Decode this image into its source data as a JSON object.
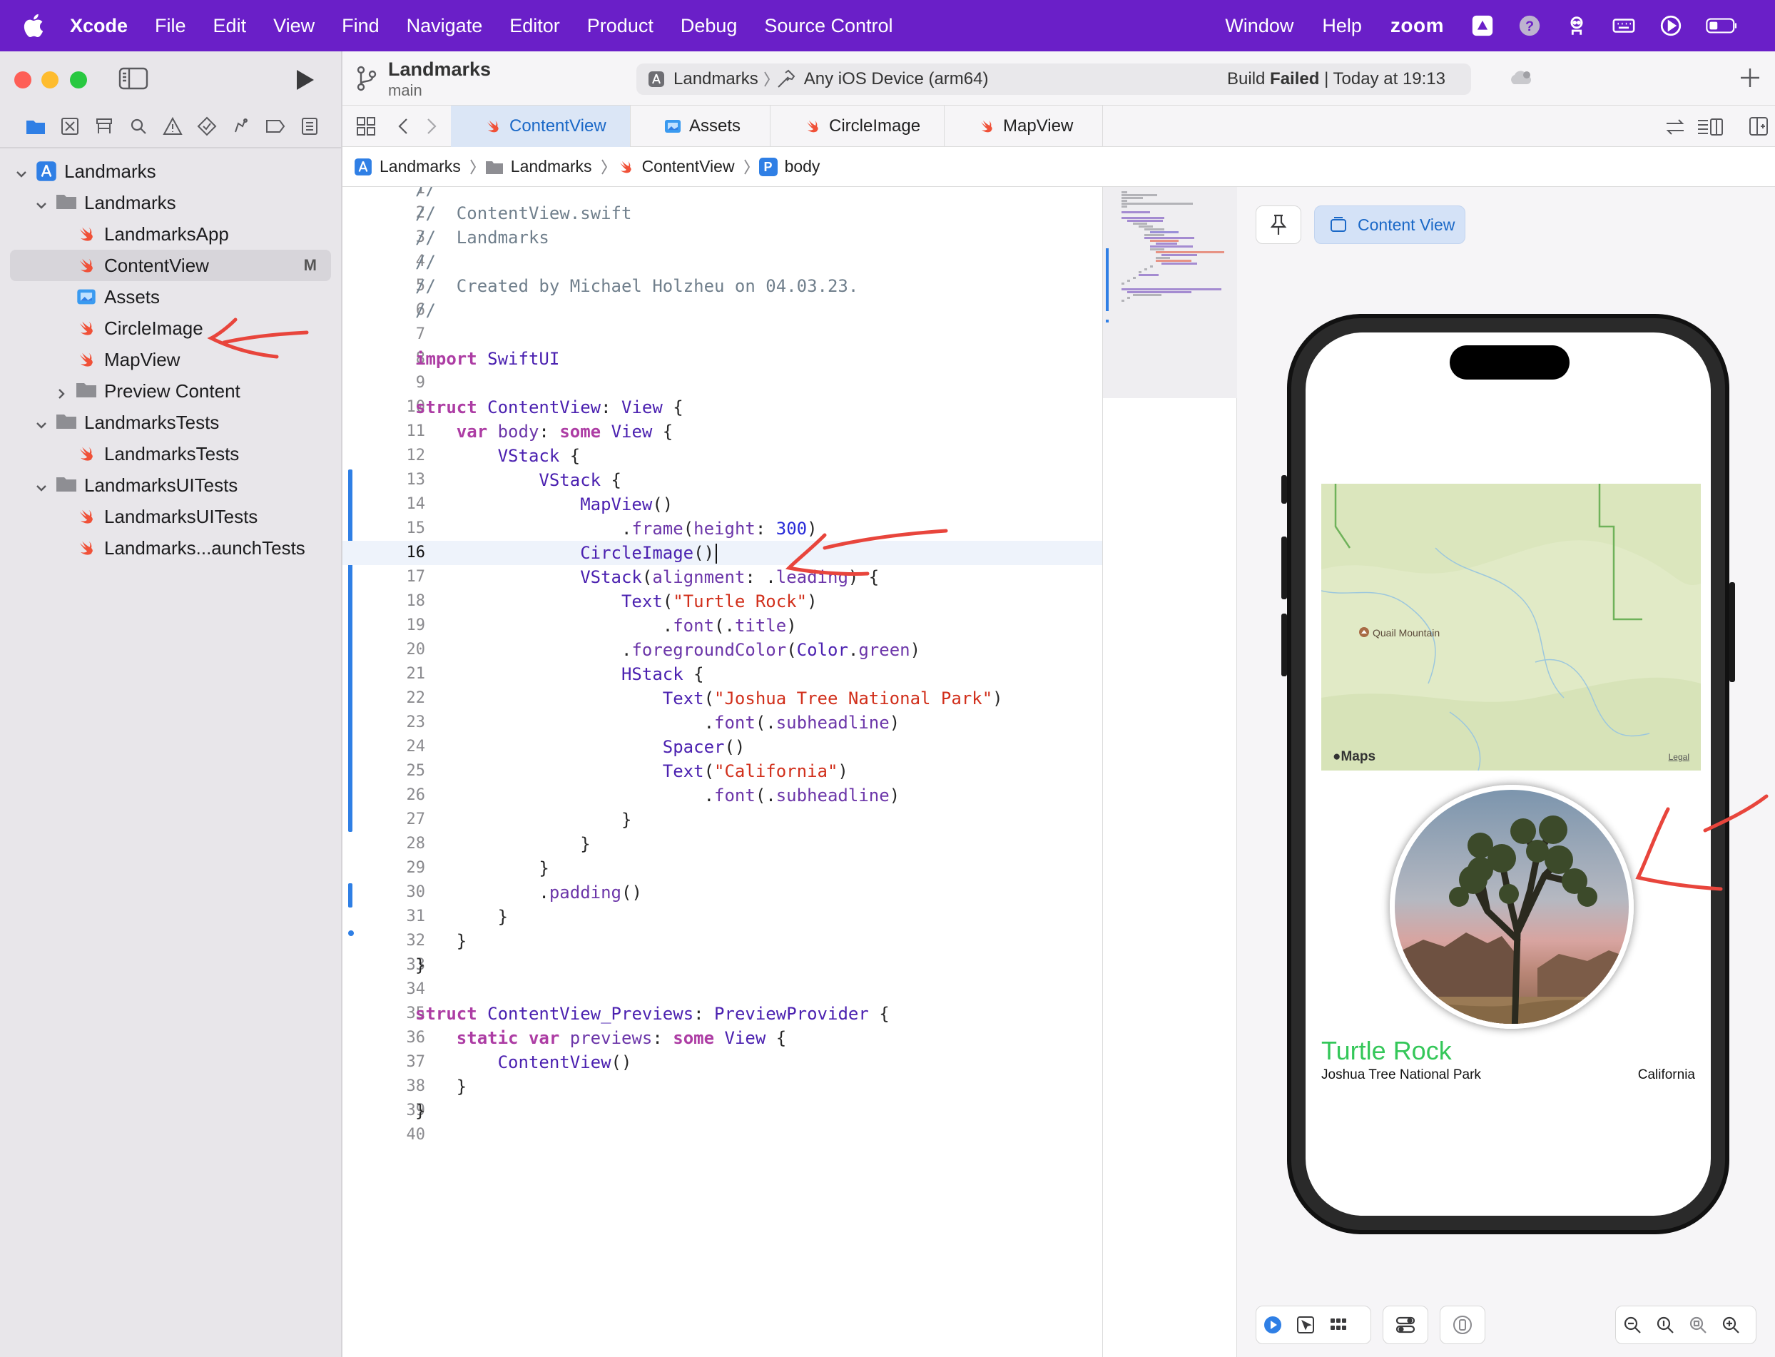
{
  "menubar": {
    "apple_icon": "apple-logo",
    "items": [
      "Xcode",
      "File",
      "Edit",
      "View",
      "Find",
      "Navigate",
      "Editor",
      "Product",
      "Debug",
      "Source Control"
    ],
    "right_items": [
      "Window",
      "Help"
    ],
    "zoom_label": "zoom",
    "status_icons": [
      "prompt-icon",
      "help-circle-icon",
      "robot-icon",
      "keyboard-icon",
      "play-circle-icon",
      "battery-icon"
    ],
    "bar_color": "#6a1fc8"
  },
  "sidebar": {
    "tree": [
      {
        "label": "Landmarks",
        "icon": "project-icon",
        "level": 0,
        "expanded": true
      },
      {
        "label": "Landmarks",
        "icon": "folder-icon",
        "level": 1,
        "expanded": true
      },
      {
        "label": "LandmarksApp",
        "icon": "swift-icon",
        "level": 2
      },
      {
        "label": "ContentView",
        "icon": "swift-icon",
        "level": 2,
        "selected": true,
        "badge": "M"
      },
      {
        "label": "Assets",
        "icon": "assets-icon",
        "level": 2
      },
      {
        "label": "CircleImage",
        "icon": "swift-icon",
        "level": 2
      },
      {
        "label": "MapView",
        "icon": "swift-icon",
        "level": 2
      },
      {
        "label": "Preview Content",
        "icon": "folder-icon",
        "level": 2,
        "expanded": false
      },
      {
        "label": "LandmarksTests",
        "icon": "folder-icon",
        "level": 1,
        "expanded": true
      },
      {
        "label": "LandmarksTests",
        "icon": "swift-icon",
        "level": 2
      },
      {
        "label": "LandmarksUITests",
        "icon": "folder-icon",
        "level": 1,
        "expanded": true
      },
      {
        "label": "LandmarksUITests",
        "icon": "swift-icon",
        "level": 2
      },
      {
        "label": "Landmarks...aunchTests",
        "icon": "swift-icon",
        "level": 2
      }
    ]
  },
  "toolbar": {
    "project": "Landmarks",
    "branch": "main",
    "scheme": "Landmarks",
    "destination": "Any iOS Device (arm64)",
    "build_status_prefix": "Build",
    "build_status": "Failed",
    "build_time": "| Today at 19:13"
  },
  "tabs": [
    {
      "label": "ContentView",
      "icon": "swift-icon",
      "active": true
    },
    {
      "label": "Assets",
      "icon": "assets-icon",
      "active": false
    },
    {
      "label": "CircleImage",
      "icon": "swift-icon",
      "active": false
    },
    {
      "label": "MapView",
      "icon": "swift-icon",
      "active": false
    }
  ],
  "jumpbar": {
    "items": [
      {
        "label": "Landmarks",
        "icon": "project-icon"
      },
      {
        "label": "Landmarks",
        "icon": "folder-icon"
      },
      {
        "label": "ContentView",
        "icon": "swift-icon"
      },
      {
        "label": "body",
        "icon": "property-icon"
      }
    ],
    "property_badge": "P"
  },
  "editor": {
    "current_line": 16,
    "lines": [
      "//",
      "//  ContentView.swift",
      "//  Landmarks",
      "//",
      "//  Created by Michael Holzheu on 04.03.23.",
      "//",
      "",
      "import SwiftUI",
      "",
      "struct ContentView: View {",
      "    var body: some View {",
      "        VStack {",
      "            VStack {",
      "                MapView()",
      "                    .frame(height: 300)",
      "                CircleImage()",
      "                VStack(alignment: .leading) {",
      "                    Text(\"Turtle Rock\")",
      "                        .font(.title)",
      "                    .foregroundColor(Color.green)",
      "                    HStack {",
      "                        Text(\"Joshua Tree National Park\")",
      "                            .font(.subheadline)",
      "                        Spacer()",
      "                        Text(\"California\")",
      "                            .font(.subheadline)",
      "                    }",
      "                }",
      "            }",
      "            .padding()",
      "        }",
      "    }",
      "}",
      "",
      "struct ContentView_Previews: PreviewProvider {",
      "    static var previews: some View {",
      "        ContentView()",
      "    }",
      "}",
      ""
    ]
  },
  "canvas": {
    "preview_button": "Content View",
    "map_place": "Quail Mountain",
    "map_logo": "Maps",
    "map_legal": "Legal",
    "title": "Turtle Rock",
    "park": "Joshua Tree National Park",
    "state": "California",
    "title_color": "#34c759",
    "bottom_controls": [
      "live-preview-icon",
      "selectable-icon",
      "variants-icon",
      "device-settings-icon",
      "orientation-icon",
      "zoom-out-icon",
      "zoom-100-icon",
      "zoom-fit-icon",
      "zoom-in-icon"
    ]
  }
}
